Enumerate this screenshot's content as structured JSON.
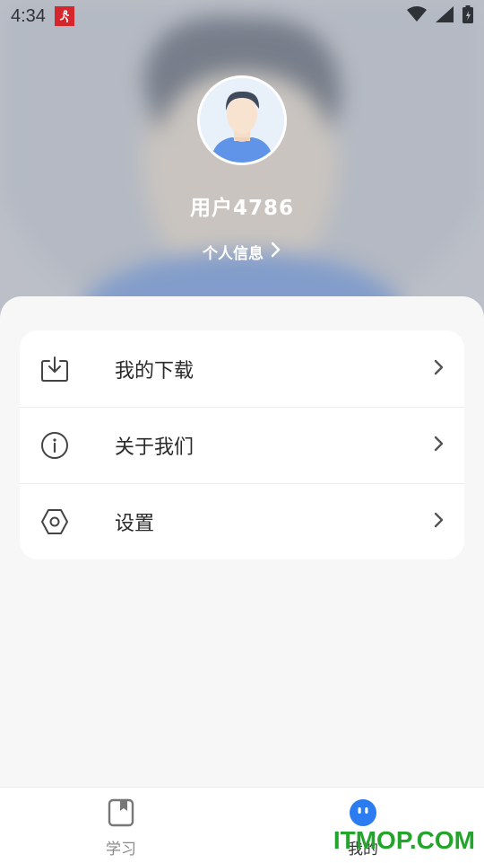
{
  "status_bar": {
    "time": "4:34",
    "app_badge_icon": "running-man-icon",
    "icons": [
      "wifi-icon",
      "signal-icon",
      "battery-charging-icon"
    ]
  },
  "profile": {
    "username": "用户4786",
    "info_link_label": "个人信息",
    "avatar_icon": "default-avatar-icon"
  },
  "menu": {
    "items": [
      {
        "label": "我的下载",
        "icon": "download-icon"
      },
      {
        "label": "关于我们",
        "icon": "info-icon"
      },
      {
        "label": "设置",
        "icon": "settings-hexagon-icon"
      }
    ]
  },
  "tabbar": {
    "tabs": [
      {
        "label": "学习",
        "icon": "book-icon",
        "active": false
      },
      {
        "label": "我的",
        "icon": "face-icon",
        "active": true
      }
    ]
  },
  "watermark": "ITMOP.COM",
  "colors": {
    "accent": "#2b7cf0",
    "watermark": "#22a52a",
    "badge": "#d5262b"
  }
}
